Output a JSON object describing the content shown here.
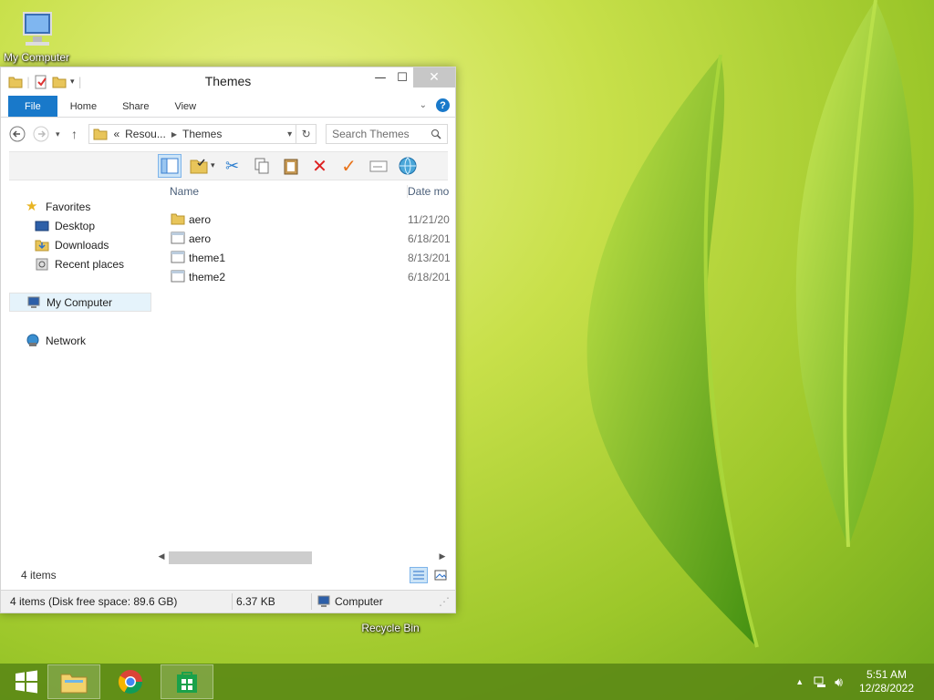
{
  "desktop": {
    "icons": {
      "my_computer": "My Computer",
      "recycle_bin": "Recycle Bin"
    }
  },
  "window": {
    "title": "Themes",
    "controls": {
      "minimize": "—",
      "maximize": "☐",
      "close": "✕"
    },
    "ribbon_tabs": [
      "File",
      "Home",
      "Share",
      "View"
    ],
    "address": {
      "overflow": "«",
      "crumbs": [
        "Resou...",
        "Themes"
      ],
      "search_placeholder": "Search Themes"
    },
    "nav_pane": {
      "favorites": "Favorites",
      "favorites_items": [
        "Desktop",
        "Downloads",
        "Recent places"
      ],
      "my_computer": "My Computer",
      "network": "Network"
    },
    "columns": {
      "name": "Name",
      "date": "Date mo"
    },
    "files": [
      {
        "name": "aero",
        "date": "11/21/20",
        "icon": "folder-icon"
      },
      {
        "name": "aero",
        "date": "6/18/201",
        "icon": "theme-file-icon"
      },
      {
        "name": "theme1",
        "date": "8/13/201",
        "icon": "theme-file-icon"
      },
      {
        "name": "theme2",
        "date": "6/18/201",
        "icon": "theme-file-icon"
      }
    ],
    "item_count": "4 items",
    "status": {
      "left": "4 items (Disk free space: 89.6 GB)",
      "size": "6.37 KB",
      "location": "Computer"
    }
  },
  "taskbar": {
    "apps": [
      "start-icon",
      "file-explorer-icon",
      "chrome-icon",
      "store-icon"
    ],
    "time": "5:51 AM",
    "date": "12/28/2022"
  },
  "colors": {
    "accent": "#1979ca",
    "taskbar": "#5c8a16"
  }
}
